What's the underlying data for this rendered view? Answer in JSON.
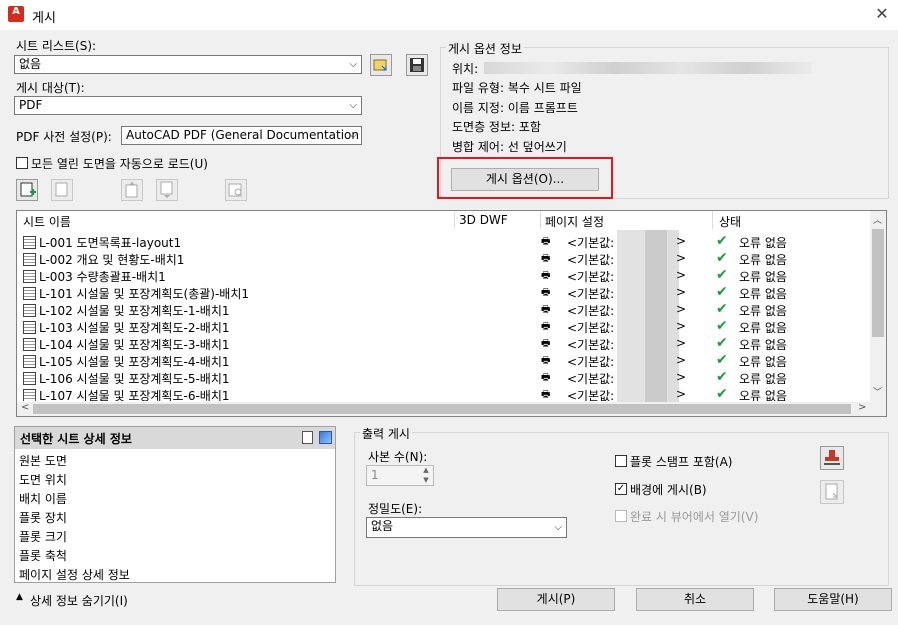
{
  "window": {
    "app_icon": "A",
    "title": "게시",
    "close": "✕"
  },
  "sheet_list": {
    "label": "시트 리스트(S):",
    "value": "없음"
  },
  "publish_to": {
    "label": "게시 대상(T):",
    "value": "PDF"
  },
  "pdf_preset": {
    "label": "PDF 사전 설정(P):",
    "value": "AutoCAD PDF (General Documentation"
  },
  "auto_load": {
    "label": "모든 열린 도면을 자동으로 로드(U)",
    "checked": false
  },
  "publish_options": {
    "group_label": "게시 옵션 정보",
    "location_label": "위치:",
    "file_type": "파일 유형: 복수 시트 파일",
    "naming": "이름 지정: 이름 프롬프트",
    "layer_info": "도면층 정보: 포함",
    "merge": "병합 제어: 선 덮어쓰기",
    "button": "게시 옵션(O)..."
  },
  "table": {
    "headers": {
      "sheet_name": "시트 이름",
      "dwf3d": "3D DWF",
      "page_setup": "페이지 설정",
      "status": "상태"
    },
    "rows": [
      {
        "name": "L-001 도면목록표-layout1",
        "setup": "<기본값:",
        "end": ">",
        "status": "오류 없음"
      },
      {
        "name": "L-002 개요 및 현황도-배치1",
        "setup": "<기본값:",
        "end": ">",
        "status": "오류 없음"
      },
      {
        "name": "L-003 수량총괄표-배치1",
        "setup": "<기본값:",
        "end": ">",
        "status": "오류 없음"
      },
      {
        "name": "L-101 시설물 및 포장계획도(총괄)-배치1",
        "setup": "<기본값:",
        "end": ">",
        "status": "오류 없음"
      },
      {
        "name": "L-102 시설물 및 포장계획도-1-배치1",
        "setup": "<기본값:",
        "end": ">",
        "status": "오류 없음"
      },
      {
        "name": "L-103 시설물 및 포장계획도-2-배치1",
        "setup": "<기본값:",
        "end": ">",
        "status": "오류 없음"
      },
      {
        "name": "L-104 시설물 및 포장계획도-3-배치1",
        "setup": "<기본값:",
        "end": ">",
        "status": "오류 없음"
      },
      {
        "name": "L-105 시설물 및 포장계획도-4-배치1",
        "setup": "<기본값:",
        "end": ">",
        "status": "오류 없음"
      },
      {
        "name": "L-106 시설물 및 포장계획도-5-배치1",
        "setup": "<기본값:",
        "end": ">",
        "status": "오류 없음"
      },
      {
        "name": "L-107 시설물 및 포장계획도-6-배치1",
        "setup": "<기본값:",
        "end": ">",
        "status": "오류 없음"
      }
    ]
  },
  "details": {
    "title": "선택한 시트 상세 정보",
    "items": [
      "원본 도면",
      "도면 위치",
      "배치 이름",
      "플롯 장치",
      "플롯 크기",
      "플롯 축척",
      "페이지 설정 상세 정보"
    ]
  },
  "output": {
    "group_label": "출력 게시",
    "copies_label": "사본 수(N):",
    "copies_value": "1",
    "precision_label": "정밀도(E):",
    "precision_value": "없음",
    "stamp_label": "플롯 스탬프 포함(A)",
    "stamp_checked": false,
    "background_label": "배경에 게시(B)",
    "background_checked": true,
    "viewer_label": "완료 시 뷰어에서 열기(V)",
    "viewer_checked": false
  },
  "footer": {
    "hide_details": "상세 정보 숨기기(I)",
    "publish": "게시(P)",
    "cancel": "취소",
    "help": "도움말(H)"
  },
  "colors": {
    "highlight_border": "#e0191f",
    "check_green": "#1f9a3a",
    "app_red": "#d52b1e"
  }
}
